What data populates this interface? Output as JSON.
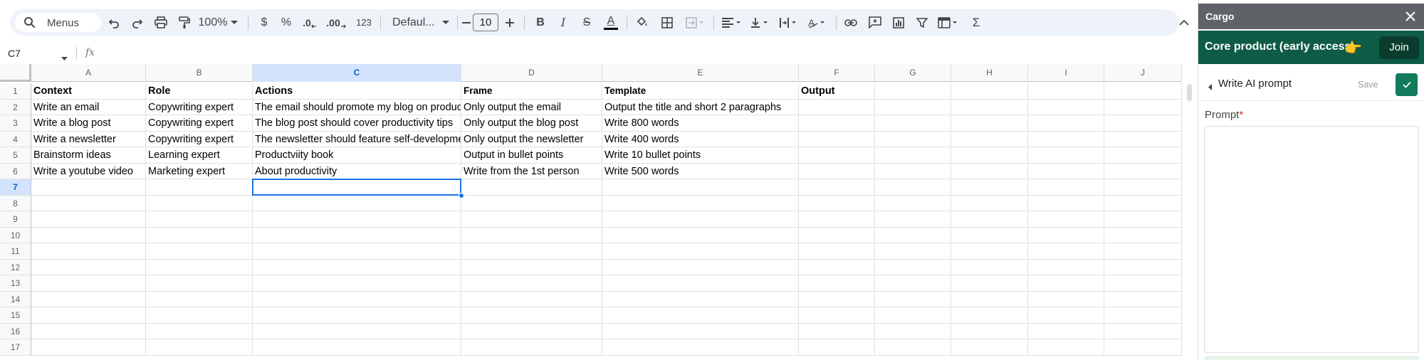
{
  "toolbar": {
    "menus_label": "Menus",
    "zoom": "100%",
    "currency_symbol": "$",
    "percent_symbol": "%",
    "decrease_decimal_label": ".0",
    "increase_decimal_label": ".00",
    "number_format_label": "123",
    "font_family": "Defaul...",
    "font_size": "10",
    "bold_label": "B",
    "italic_label": "I",
    "strikethrough_label": "S",
    "text_color_label": "A",
    "text_color": "#000000",
    "sum_label": "Σ"
  },
  "formula_bar": {
    "name_box": "C7",
    "fx_label": "fx",
    "value": ""
  },
  "grid": {
    "columns": [
      "A",
      "B",
      "C",
      "D",
      "E",
      "F",
      "G",
      "H",
      "I",
      "J"
    ],
    "selected_column": "C",
    "rows": [
      "1",
      "2",
      "3",
      "4",
      "5",
      "6",
      "7",
      "8",
      "9",
      "10",
      "11",
      "12",
      "13",
      "14",
      "15",
      "16",
      "17"
    ],
    "selected_row": "7",
    "selected_cell": "C7",
    "cells": [
      [
        "Context",
        "Role",
        "Actions",
        "Frame",
        "Template",
        "Output"
      ],
      [
        "Write an email",
        "Copywriting expert",
        "The email should promote my blog on productivity",
        "Only output the email",
        "Output the title and short 2 paragraphs",
        ""
      ],
      [
        "Write a blog post",
        "Copywriting expert",
        "The blog post should cover productivity tips",
        "Only output the blog post",
        "Write 800 words",
        ""
      ],
      [
        "Write a newsletter",
        "Copywriting expert",
        "The newsletter should feature self-development",
        "Only output the newsletter",
        "Write 400 words",
        ""
      ],
      [
        "Brainstorm ideas",
        "Learning expert",
        "Productviity book",
        "Output in bullet points",
        "Write 10 bullet points",
        ""
      ],
      [
        "Write a youtube video",
        "Marketing expert",
        "About productivity",
        "Write from the 1st person",
        "Write 500 words",
        ""
      ]
    ]
  },
  "panel": {
    "title": "Cargo",
    "promo_text": "Core product (early access)",
    "promo_emoji": "👉",
    "join_label": "Join",
    "step_title": "Write AI prompt",
    "save_label": "Save",
    "prompt_label": "Prompt",
    "prompt_required_mark": "*",
    "prompt_value": ""
  },
  "colors": {
    "selection": "#1a73e8",
    "header_selected_bg": "#d3e3fd",
    "panel_header": "#5f6368",
    "promo_bg": "#0e5c45",
    "join_bg": "#0a3d2e",
    "confirm_bg": "#137a5c"
  }
}
